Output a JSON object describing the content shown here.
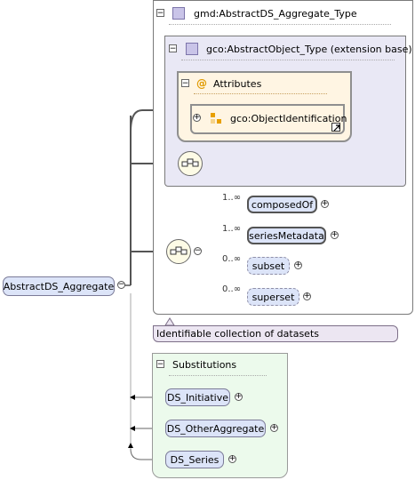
{
  "root": {
    "label": "AbstractDS_Aggregate"
  },
  "complex_type": {
    "label": "gmd:AbstractDS_Aggregate_Type"
  },
  "extension": {
    "label": "gco:AbstractObject_Type (extension base)"
  },
  "attributes": {
    "label": "Attributes",
    "icon_symbol": "@"
  },
  "attribute_group": {
    "label": "gco:ObjectIdentification"
  },
  "children": [
    {
      "name": "composedOf",
      "multiplicity": "1..∞"
    },
    {
      "name": "seriesMetadata",
      "multiplicity": "1..∞"
    },
    {
      "name": "subset",
      "multiplicity": "0..∞"
    },
    {
      "name": "superset",
      "multiplicity": "0..∞"
    }
  ],
  "documentation": "Identifiable collection of datasets",
  "substitutions": {
    "title": "Substitutions",
    "items": [
      "DS_Initiative",
      "DS_OtherAggregate",
      "DS_Series"
    ]
  },
  "colors": {
    "element_fill": "#dce4f8",
    "type_fill": "#e9e8f5",
    "attribute_fill": "#fff5e3",
    "substitution_fill": "#ecfaec",
    "doc_fill": "#ece6f2"
  }
}
